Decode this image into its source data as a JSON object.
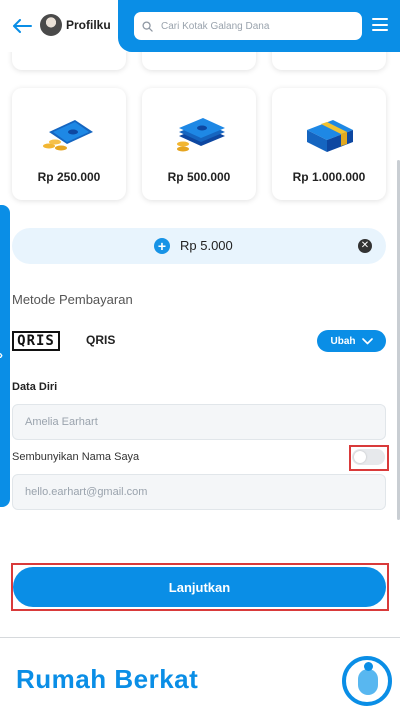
{
  "header": {
    "profile_label": "Profilku",
    "search_placeholder": "Cari Kotak Galang Dana"
  },
  "amount_cards": [
    {
      "label": "Rp 250.000",
      "icon": "cash-coins-icon"
    },
    {
      "label": "Rp 500.000",
      "icon": "cash-stack-icon"
    },
    {
      "label": "Rp 1.000.000",
      "icon": "money-bundle-icon"
    }
  ],
  "custom_amount": {
    "value": "Rp 5.000"
  },
  "payment": {
    "section_title": "Metode Pembayaran",
    "method_logo": "QRIS",
    "method_name": "QRIS",
    "change_label": "Ubah"
  },
  "personal_data": {
    "title": "Data Diri",
    "name_placeholder": "Amelia Earhart",
    "hide_name_label": "Sembunyikan Nama Saya",
    "hide_name_enabled": false,
    "email_placeholder": "hello.earhart@gmail.com"
  },
  "submit": {
    "label": "Lanjutkan"
  },
  "footer": {
    "brand": "Rumah Berkat"
  },
  "colors": {
    "primary": "#0a8ee6",
    "highlight": "#d93a3a"
  }
}
